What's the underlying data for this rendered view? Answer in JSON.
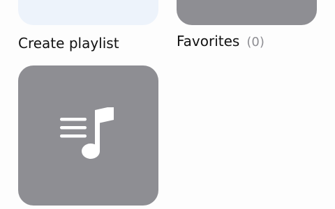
{
  "playlists": {
    "create": {
      "label": "Create playlist"
    },
    "favorites": {
      "label": "Favorites",
      "count": "(0)"
    },
    "playlist_tile": {
      "icon": "playlist-music-icon"
    }
  },
  "colors": {
    "tile_gray": "#8e8e93",
    "create_tile": "#edf3fb",
    "text": "#111111",
    "muted": "#8e8e93"
  }
}
